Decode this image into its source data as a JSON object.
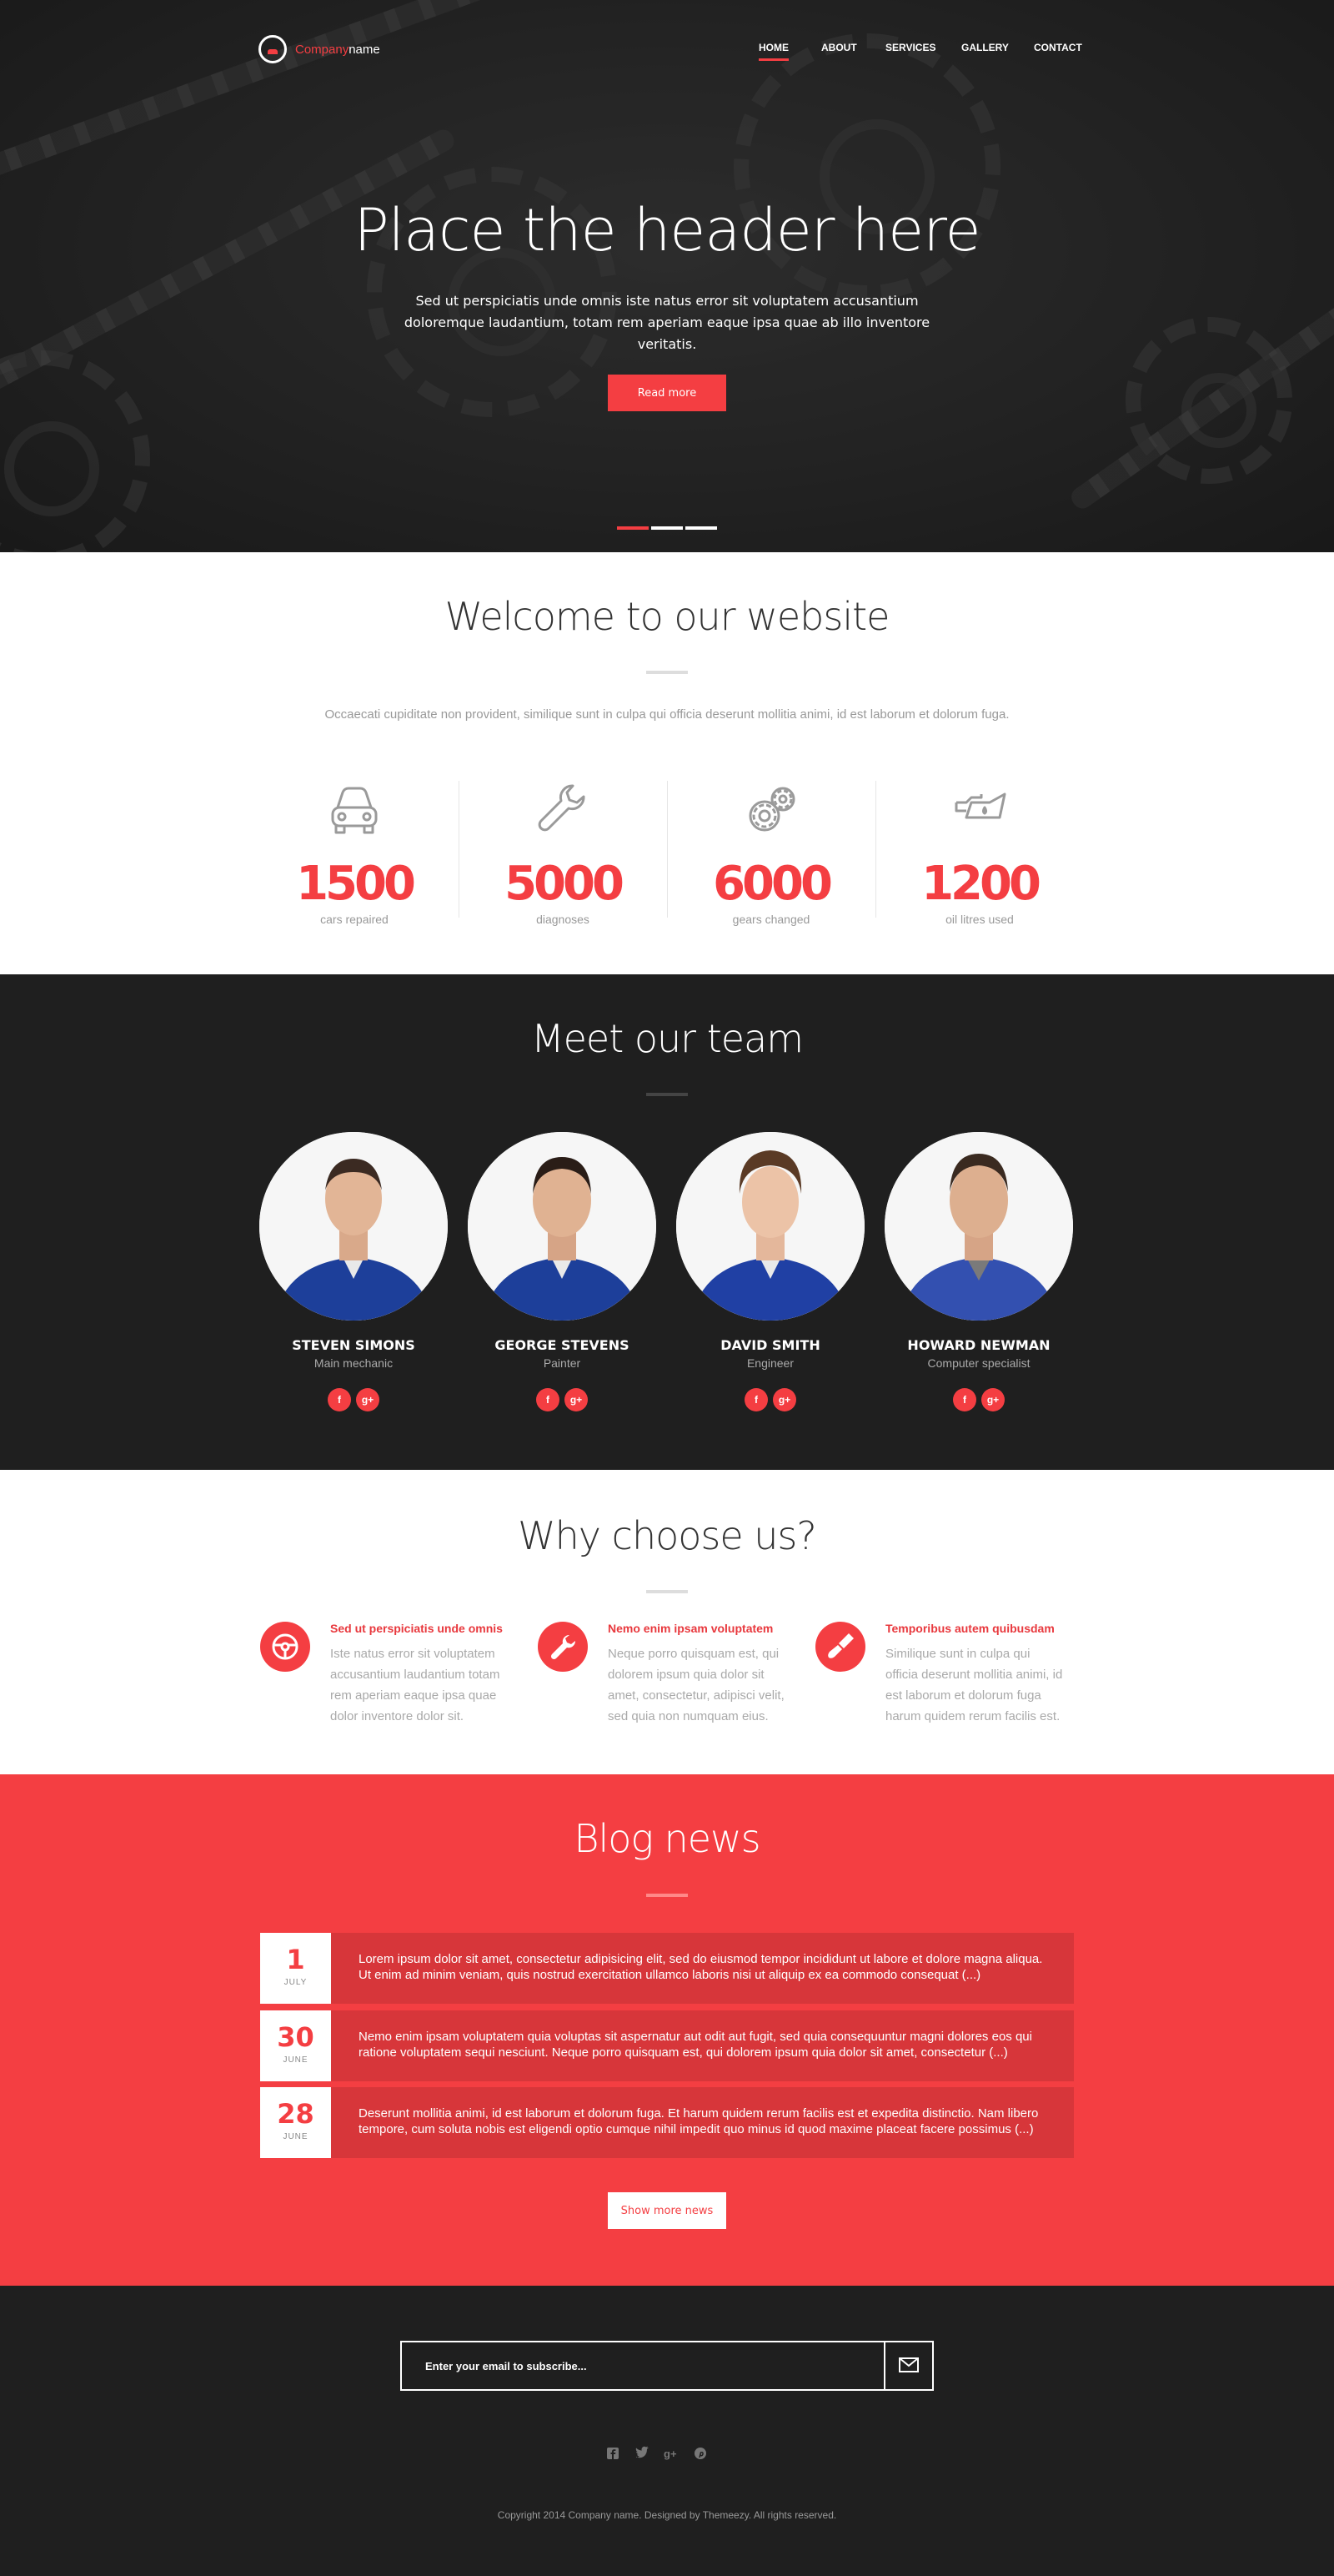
{
  "brand": {
    "name_red": "Company",
    "name_white": "name"
  },
  "nav": {
    "items": [
      "HOME",
      "ABOUT",
      "SERVICES",
      "GALLERY",
      "CONTACT"
    ],
    "active": "HOME"
  },
  "hero": {
    "title": "Place the header here",
    "text": "Sed ut perspiciatis unde omnis iste natus error sit voluptatem accusantium doloremque laudantium, totam rem aperiam eaque ipsa quae ab illo inventore veritatis.",
    "button": "Read more",
    "slides": 3,
    "active_slide": 1
  },
  "welcome": {
    "title": "Welcome to our website",
    "subtitle": "Occaecati cupiditate non provident, similique sunt in culpa qui officia deserunt mollitia animi, id est laborum et dolorum fuga.",
    "stats": [
      {
        "icon": "car-icon",
        "value": "1500",
        "label": "cars repaired"
      },
      {
        "icon": "wrench-icon",
        "value": "5000",
        "label": "diagnoses"
      },
      {
        "icon": "gears-icon",
        "value": "6000",
        "label": "gears changed"
      },
      {
        "icon": "oil-can-icon",
        "value": "1200",
        "label": "oil litres used"
      }
    ]
  },
  "team": {
    "title": "Meet our team",
    "members": [
      {
        "name": "STEVEN SIMONS",
        "role": "Main mechanic",
        "socials": [
          "f",
          "g+"
        ]
      },
      {
        "name": "GEORGE STEVENS",
        "role": "Painter",
        "socials": [
          "f",
          "g+"
        ]
      },
      {
        "name": "DAVID SMITH",
        "role": "Engineer",
        "socials": [
          "f",
          "g+"
        ]
      },
      {
        "name": "HOWARD NEWMAN",
        "role": "Computer specialist",
        "socials": [
          "f",
          "g+"
        ]
      }
    ]
  },
  "why": {
    "title": "Why choose us?",
    "features": [
      {
        "icon": "steering-wheel-icon",
        "title": "Sed ut perspiciatis unde omnis",
        "text": "Iste natus error sit voluptatem accusantium laudantium totam rem aperiam eaque ipsa quae dolor inventore dolor sit."
      },
      {
        "icon": "wrench-icon",
        "title": "Nemo enim ipsam voluptatem",
        "text": "Neque porro quisquam est, qui dolorem ipsum quia dolor sit amet, consectetur, adipisci velit, sed quia non numquam eius."
      },
      {
        "icon": "paint-brush-icon",
        "title": "Temporibus autem quibusdam",
        "text": "Similique sunt in culpa qui officia deserunt mollitia animi, id est laborum et dolorum fuga harum quidem rerum facilis est."
      }
    ]
  },
  "blog": {
    "title": "Blog news",
    "posts": [
      {
        "day": "1",
        "month": "JULY",
        "text": "Lorem ipsum dolor sit amet, consectetur adipisicing elit, sed do eiusmod tempor incididunt ut labore et dolore magna aliqua. Ut enim ad minim veniam, quis nostrud exercitation ullamco laboris nisi ut aliquip ex ea commodo consequat (...)"
      },
      {
        "day": "30",
        "month": "JUNE",
        "text": "Nemo enim ipsam voluptatem quia voluptas sit aspernatur aut odit aut fugit, sed quia consequuntur magni dolores eos qui ratione voluptatem sequi nesciunt. Neque porro quisquam est, qui dolorem ipsum quia dolor sit amet, consectetur (...)"
      },
      {
        "day": "28",
        "month": "JUNE",
        "text": "Deserunt mollitia animi, id est laborum et dolorum fuga. Et harum quidem rerum facilis est et expedita distinctio. Nam libero tempore, cum soluta nobis est eligendi optio cumque nihil impedit quo minus id quod maxime placeat facere possimus (...)"
      }
    ],
    "button": "Show more news"
  },
  "footer": {
    "subscribe_placeholder": "Enter your email to subscribe...",
    "send_icon": "envelope-icon",
    "socials": [
      "facebook-icon",
      "twitter-icon",
      "google-plus-icon",
      "pinterest-icon"
    ],
    "copyright": "Copyright 2014 Company name. Designed by Themeezy. All rights reserved."
  },
  "colors": {
    "accent": "#f43e42",
    "dark": "#1f1f1f",
    "muted": "#999999"
  }
}
